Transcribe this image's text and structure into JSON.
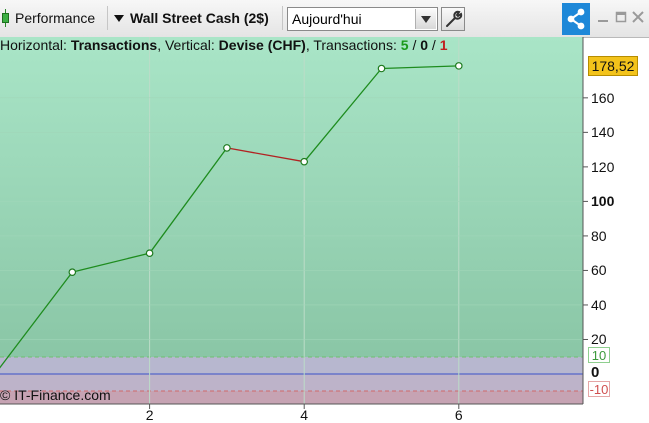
{
  "toolbar": {
    "performance_label": "Performance",
    "instrument_label": "Wall Street Cash (2$)",
    "period_value": "Aujourd'hui",
    "icons": [
      "candlestick-icon",
      "chevron-down-icon",
      "wrench-icon",
      "share-icon",
      "minimize-icon",
      "maximize-icon",
      "close-icon"
    ]
  },
  "header": {
    "horizontal_label": "Horizontal:",
    "horizontal_value": "Transactions",
    "vertical_label": "Vertical:",
    "vertical_value": "Devise (CHF)",
    "transactions_label": "Transactions:",
    "wins": "5",
    "neutral": "0",
    "losses": "1",
    "slash": "/"
  },
  "copyright": "© IT-Finance.com",
  "last_value_label": "178,52",
  "colors": {
    "bg_top": "#a8e3c5",
    "bg_bottom": "#8dc9a8",
    "line_up": "#1e8c1e",
    "line_down": "#b22222",
    "accent_share": "#1e88d8",
    "price_tag": "#f3c31b"
  },
  "chart_data": {
    "type": "line",
    "x": [
      0,
      1,
      2,
      3,
      4,
      5,
      6
    ],
    "y": [
      0,
      59,
      70,
      131,
      123,
      177,
      178.52
    ],
    "segment_colors": [
      "up",
      "up",
      "up",
      "down",
      "up",
      "up"
    ],
    "xticks": [
      "2",
      "4",
      "6"
    ],
    "yticks": [
      {
        "v": 20,
        "t": "20",
        "bold": false
      },
      {
        "v": 40,
        "t": "40",
        "bold": false
      },
      {
        "v": 60,
        "t": "60",
        "bold": false
      },
      {
        "v": 80,
        "t": "80",
        "bold": false
      },
      {
        "v": 100,
        "t": "100",
        "bold": true
      },
      {
        "v": 120,
        "t": "120",
        "bold": false
      },
      {
        "v": 140,
        "t": "140",
        "bold": false
      },
      {
        "v": 160,
        "t": "160",
        "bold": false
      }
    ],
    "band_upper": "10",
    "band_lower": "-10",
    "zero_label": "0",
    "xlim": [
      0,
      7.5
    ],
    "ylim": [
      -17,
      195
    ]
  }
}
